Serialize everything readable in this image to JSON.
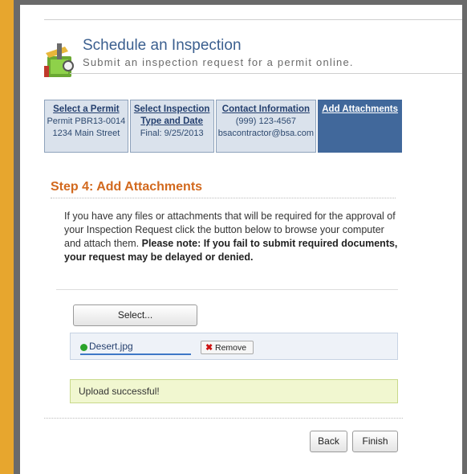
{
  "header": {
    "title": "Schedule an Inspection",
    "subtitle": "Submit an inspection request for a permit online."
  },
  "steps": [
    {
      "title": "Select a Permit",
      "lines": [
        "Permit PBR13-0014",
        "1234 Main Street"
      ]
    },
    {
      "title": "Select Inspection Type and Date",
      "title_line1": "Select Inspection",
      "title_line2": "Type and Date",
      "lines": [
        "Final: 9/25/2013"
      ]
    },
    {
      "title": "Contact Information",
      "lines": [
        "(999) 123-4567",
        "bsacontractor@bsa.com"
      ]
    },
    {
      "title": "Add Attachments",
      "lines": []
    }
  ],
  "main": {
    "heading": "Step 4: Add Attachments",
    "intro": "If you have any files or attachments that will be required for the approval of your Inspection Request click the button below to browse your computer and attach them.",
    "note": "Please note: If you fail to submit required documents, your request may be delayed or denied."
  },
  "upload": {
    "select_label": "Select...",
    "file_name": "Desert.jpg",
    "remove_label": "Remove",
    "status_text": "Upload successful!"
  },
  "footer": {
    "back_label": "Back",
    "finish_label": "Finish"
  },
  "colors": {
    "accent": "#41689b",
    "heading": "#d2691e",
    "success_bg": "#f1f7d0",
    "file_ok": "#2aa32a"
  }
}
